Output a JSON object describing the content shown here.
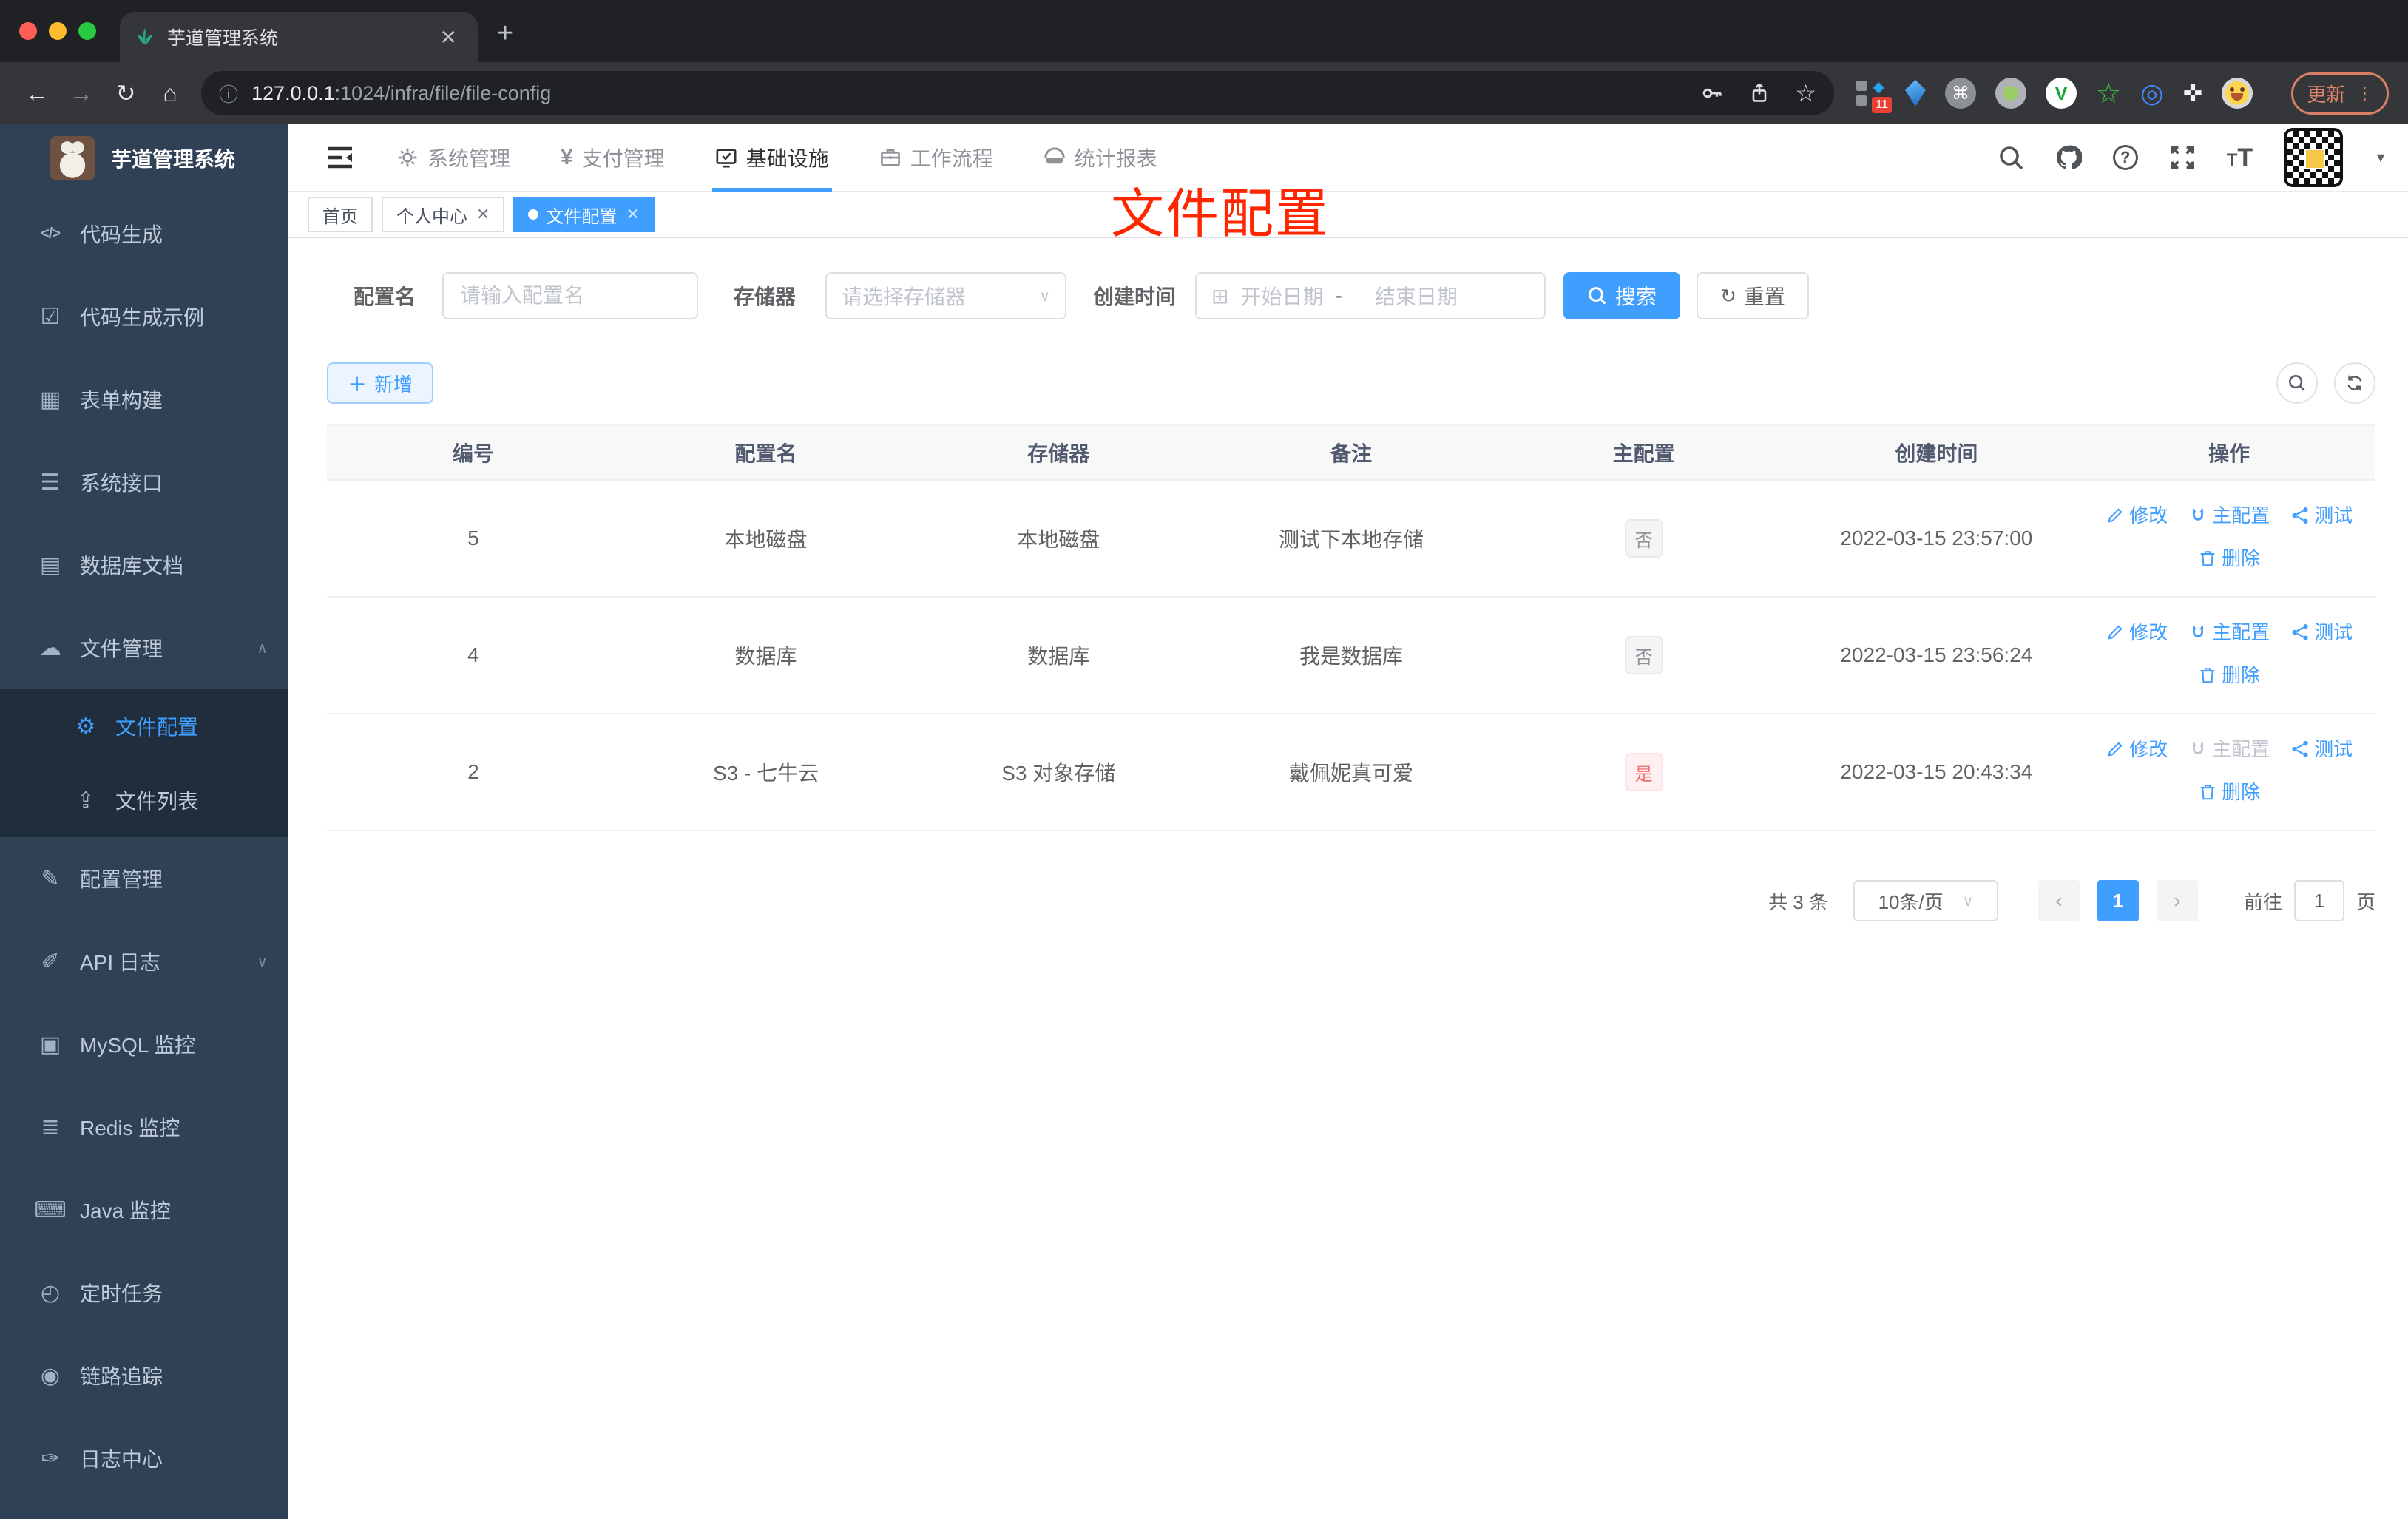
{
  "browser": {
    "tab": {
      "title": "芋道管理系统"
    },
    "url": {
      "host": "127.0.0.1",
      "path": ":1024/infra/file/file-config"
    },
    "update_button": "更新",
    "extension_badge": "11"
  },
  "sidebar": {
    "logo_title": "芋道管理系统",
    "menu": [
      {
        "key": "code-gen",
        "label": "代码生成",
        "icon": "code-icon",
        "glyph": "</>"
      },
      {
        "key": "code-gen-demo",
        "label": "代码生成示例",
        "icon": "shield-check-icon",
        "glyph": "☑"
      },
      {
        "key": "form-builder",
        "label": "表单构建",
        "icon": "form-grid-icon",
        "glyph": "▦"
      },
      {
        "key": "system-api",
        "label": "系统接口",
        "icon": "sliders-icon",
        "glyph": "☰"
      },
      {
        "key": "db-doc",
        "label": "数据库文档",
        "icon": "database-doc-icon",
        "glyph": "▤"
      },
      {
        "key": "file-manage",
        "label": "文件管理",
        "icon": "cloud-download-icon",
        "glyph": "☁",
        "expanded": true,
        "children": [
          {
            "key": "file-config",
            "label": "文件配置",
            "icon": "gear-icon",
            "glyph": "⚙",
            "active": true
          },
          {
            "key": "file-list",
            "label": "文件列表",
            "icon": "cloud-upload-icon",
            "glyph": "⇪"
          }
        ]
      },
      {
        "key": "config-manage",
        "label": "配置管理",
        "icon": "edit-icon",
        "glyph": "✎"
      },
      {
        "key": "api-log",
        "label": "API 日志",
        "icon": "log-edit-icon",
        "glyph": "✐",
        "collapsible": true
      },
      {
        "key": "mysql-monitor",
        "label": "MySQL 监控",
        "icon": "monitor-icon",
        "glyph": "▣"
      },
      {
        "key": "redis-monitor",
        "label": "Redis 监控",
        "icon": "stack-icon",
        "glyph": "≣"
      },
      {
        "key": "java-monitor",
        "label": "Java 监控",
        "icon": "console-icon",
        "glyph": "⌨"
      },
      {
        "key": "cron-job",
        "label": "定时任务",
        "icon": "timer-icon",
        "glyph": "◴"
      },
      {
        "key": "trace",
        "label": "链路追踪",
        "icon": "eye-icon",
        "glyph": "◉"
      },
      {
        "key": "log-center",
        "label": "日志中心",
        "icon": "log-center-icon",
        "glyph": "✑"
      }
    ]
  },
  "header": {
    "nav": [
      {
        "key": "system",
        "label": "系统管理",
        "icon": "gear-icon"
      },
      {
        "key": "payment",
        "label": "支付管理",
        "icon": "yen-icon"
      },
      {
        "key": "infra",
        "label": "基础设施",
        "icon": "monitor-check-icon",
        "active": true
      },
      {
        "key": "workflow",
        "label": "工作流程",
        "icon": "briefcase-icon"
      },
      {
        "key": "report",
        "label": "统计报表",
        "icon": "dashboard-icon"
      }
    ]
  },
  "tags_view": {
    "tags": [
      {
        "key": "home",
        "label": "首页"
      },
      {
        "key": "profile",
        "label": "个人中心",
        "closable": true
      },
      {
        "key": "file-config",
        "label": "文件配置",
        "closable": true,
        "active": true
      }
    ]
  },
  "overlay_title": "文件配置",
  "filters": {
    "name_label": "配置名",
    "name_placeholder": "请输入配置名",
    "storage_label": "存储器",
    "storage_placeholder": "请选择存储器",
    "date_label": "创建时间",
    "date_start_placeholder": "开始日期",
    "date_separator": "-",
    "date_end_placeholder": "结束日期",
    "search_button": "搜索",
    "reset_button": "重置"
  },
  "toolbar": {
    "add_button": "新增"
  },
  "table": {
    "headers": [
      "编号",
      "配置名",
      "存储器",
      "备注",
      "主配置",
      "创建时间",
      "操作"
    ],
    "actions": {
      "edit": "修改",
      "master": "主配置",
      "test": "测试",
      "delete": "删除"
    },
    "rows": [
      {
        "id": "5",
        "name": "本地磁盘",
        "storage": "本地磁盘",
        "remark": "测试下本地存储",
        "master": "否",
        "master_type": "info",
        "created": "2022-03-15 23:57:00",
        "master_action_disabled": false
      },
      {
        "id": "4",
        "name": "数据库",
        "storage": "数据库",
        "remark": "我是数据库",
        "master": "否",
        "master_type": "info",
        "created": "2022-03-15 23:56:24",
        "master_action_disabled": false
      },
      {
        "id": "2",
        "name": "S3 - 七牛云",
        "storage": "S3 对象存储",
        "remark": "戴佩妮真可爱",
        "master": "是",
        "master_type": "danger",
        "created": "2022-03-15 20:43:34",
        "master_action_disabled": true
      }
    ]
  },
  "pagination": {
    "total_text": "共 3 条",
    "page_size": "10条/页",
    "current_page": "1",
    "goto_label": "前往",
    "goto_value": "1",
    "page_unit": "页"
  },
  "colors": {
    "primary": "#409eff",
    "danger": "#f56c6c",
    "sidebar_bg": "#304156",
    "submenu_bg": "#1f2d3d",
    "overlay_red": "#ff2600"
  }
}
